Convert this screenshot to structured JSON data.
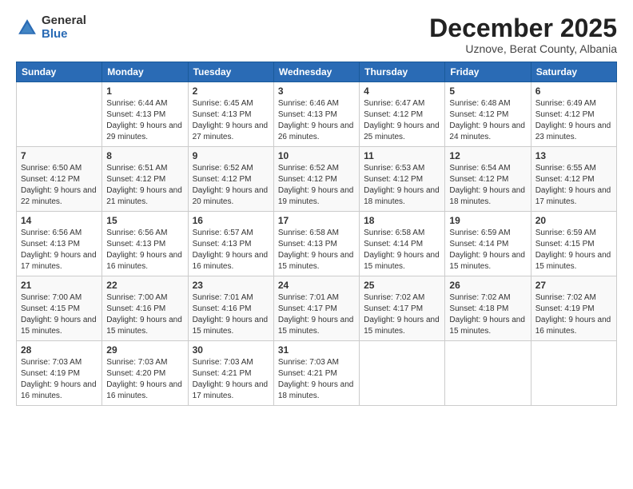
{
  "header": {
    "logo_general": "General",
    "logo_blue": "Blue",
    "main_title": "December 2025",
    "subtitle": "Uznove, Berat County, Albania"
  },
  "days_of_week": [
    "Sunday",
    "Monday",
    "Tuesday",
    "Wednesday",
    "Thursday",
    "Friday",
    "Saturday"
  ],
  "weeks": [
    [
      {
        "day": "",
        "sunrise": "",
        "sunset": "",
        "daylight": ""
      },
      {
        "day": "1",
        "sunrise": "6:44 AM",
        "sunset": "4:13 PM",
        "daylight": "9 hours and 29 minutes."
      },
      {
        "day": "2",
        "sunrise": "6:45 AM",
        "sunset": "4:13 PM",
        "daylight": "9 hours and 27 minutes."
      },
      {
        "day": "3",
        "sunrise": "6:46 AM",
        "sunset": "4:13 PM",
        "daylight": "9 hours and 26 minutes."
      },
      {
        "day": "4",
        "sunrise": "6:47 AM",
        "sunset": "4:12 PM",
        "daylight": "9 hours and 25 minutes."
      },
      {
        "day": "5",
        "sunrise": "6:48 AM",
        "sunset": "4:12 PM",
        "daylight": "9 hours and 24 minutes."
      },
      {
        "day": "6",
        "sunrise": "6:49 AM",
        "sunset": "4:12 PM",
        "daylight": "9 hours and 23 minutes."
      }
    ],
    [
      {
        "day": "7",
        "sunrise": "6:50 AM",
        "sunset": "4:12 PM",
        "daylight": "9 hours and 22 minutes."
      },
      {
        "day": "8",
        "sunrise": "6:51 AM",
        "sunset": "4:12 PM",
        "daylight": "9 hours and 21 minutes."
      },
      {
        "day": "9",
        "sunrise": "6:52 AM",
        "sunset": "4:12 PM",
        "daylight": "9 hours and 20 minutes."
      },
      {
        "day": "10",
        "sunrise": "6:52 AM",
        "sunset": "4:12 PM",
        "daylight": "9 hours and 19 minutes."
      },
      {
        "day": "11",
        "sunrise": "6:53 AM",
        "sunset": "4:12 PM",
        "daylight": "9 hours and 18 minutes."
      },
      {
        "day": "12",
        "sunrise": "6:54 AM",
        "sunset": "4:12 PM",
        "daylight": "9 hours and 18 minutes."
      },
      {
        "day": "13",
        "sunrise": "6:55 AM",
        "sunset": "4:12 PM",
        "daylight": "9 hours and 17 minutes."
      }
    ],
    [
      {
        "day": "14",
        "sunrise": "6:56 AM",
        "sunset": "4:13 PM",
        "daylight": "9 hours and 17 minutes."
      },
      {
        "day": "15",
        "sunrise": "6:56 AM",
        "sunset": "4:13 PM",
        "daylight": "9 hours and 16 minutes."
      },
      {
        "day": "16",
        "sunrise": "6:57 AM",
        "sunset": "4:13 PM",
        "daylight": "9 hours and 16 minutes."
      },
      {
        "day": "17",
        "sunrise": "6:58 AM",
        "sunset": "4:13 PM",
        "daylight": "9 hours and 15 minutes."
      },
      {
        "day": "18",
        "sunrise": "6:58 AM",
        "sunset": "4:14 PM",
        "daylight": "9 hours and 15 minutes."
      },
      {
        "day": "19",
        "sunrise": "6:59 AM",
        "sunset": "4:14 PM",
        "daylight": "9 hours and 15 minutes."
      },
      {
        "day": "20",
        "sunrise": "6:59 AM",
        "sunset": "4:15 PM",
        "daylight": "9 hours and 15 minutes."
      }
    ],
    [
      {
        "day": "21",
        "sunrise": "7:00 AM",
        "sunset": "4:15 PM",
        "daylight": "9 hours and 15 minutes."
      },
      {
        "day": "22",
        "sunrise": "7:00 AM",
        "sunset": "4:16 PM",
        "daylight": "9 hours and 15 minutes."
      },
      {
        "day": "23",
        "sunrise": "7:01 AM",
        "sunset": "4:16 PM",
        "daylight": "9 hours and 15 minutes."
      },
      {
        "day": "24",
        "sunrise": "7:01 AM",
        "sunset": "4:17 PM",
        "daylight": "9 hours and 15 minutes."
      },
      {
        "day": "25",
        "sunrise": "7:02 AM",
        "sunset": "4:17 PM",
        "daylight": "9 hours and 15 minutes."
      },
      {
        "day": "26",
        "sunrise": "7:02 AM",
        "sunset": "4:18 PM",
        "daylight": "9 hours and 15 minutes."
      },
      {
        "day": "27",
        "sunrise": "7:02 AM",
        "sunset": "4:19 PM",
        "daylight": "9 hours and 16 minutes."
      }
    ],
    [
      {
        "day": "28",
        "sunrise": "7:03 AM",
        "sunset": "4:19 PM",
        "daylight": "9 hours and 16 minutes."
      },
      {
        "day": "29",
        "sunrise": "7:03 AM",
        "sunset": "4:20 PM",
        "daylight": "9 hours and 16 minutes."
      },
      {
        "day": "30",
        "sunrise": "7:03 AM",
        "sunset": "4:21 PM",
        "daylight": "9 hours and 17 minutes."
      },
      {
        "day": "31",
        "sunrise": "7:03 AM",
        "sunset": "4:21 PM",
        "daylight": "9 hours and 18 minutes."
      },
      {
        "day": "",
        "sunrise": "",
        "sunset": "",
        "daylight": ""
      },
      {
        "day": "",
        "sunrise": "",
        "sunset": "",
        "daylight": ""
      },
      {
        "day": "",
        "sunrise": "",
        "sunset": "",
        "daylight": ""
      }
    ]
  ],
  "labels": {
    "sunrise": "Sunrise:",
    "sunset": "Sunset:",
    "daylight": "Daylight:"
  }
}
